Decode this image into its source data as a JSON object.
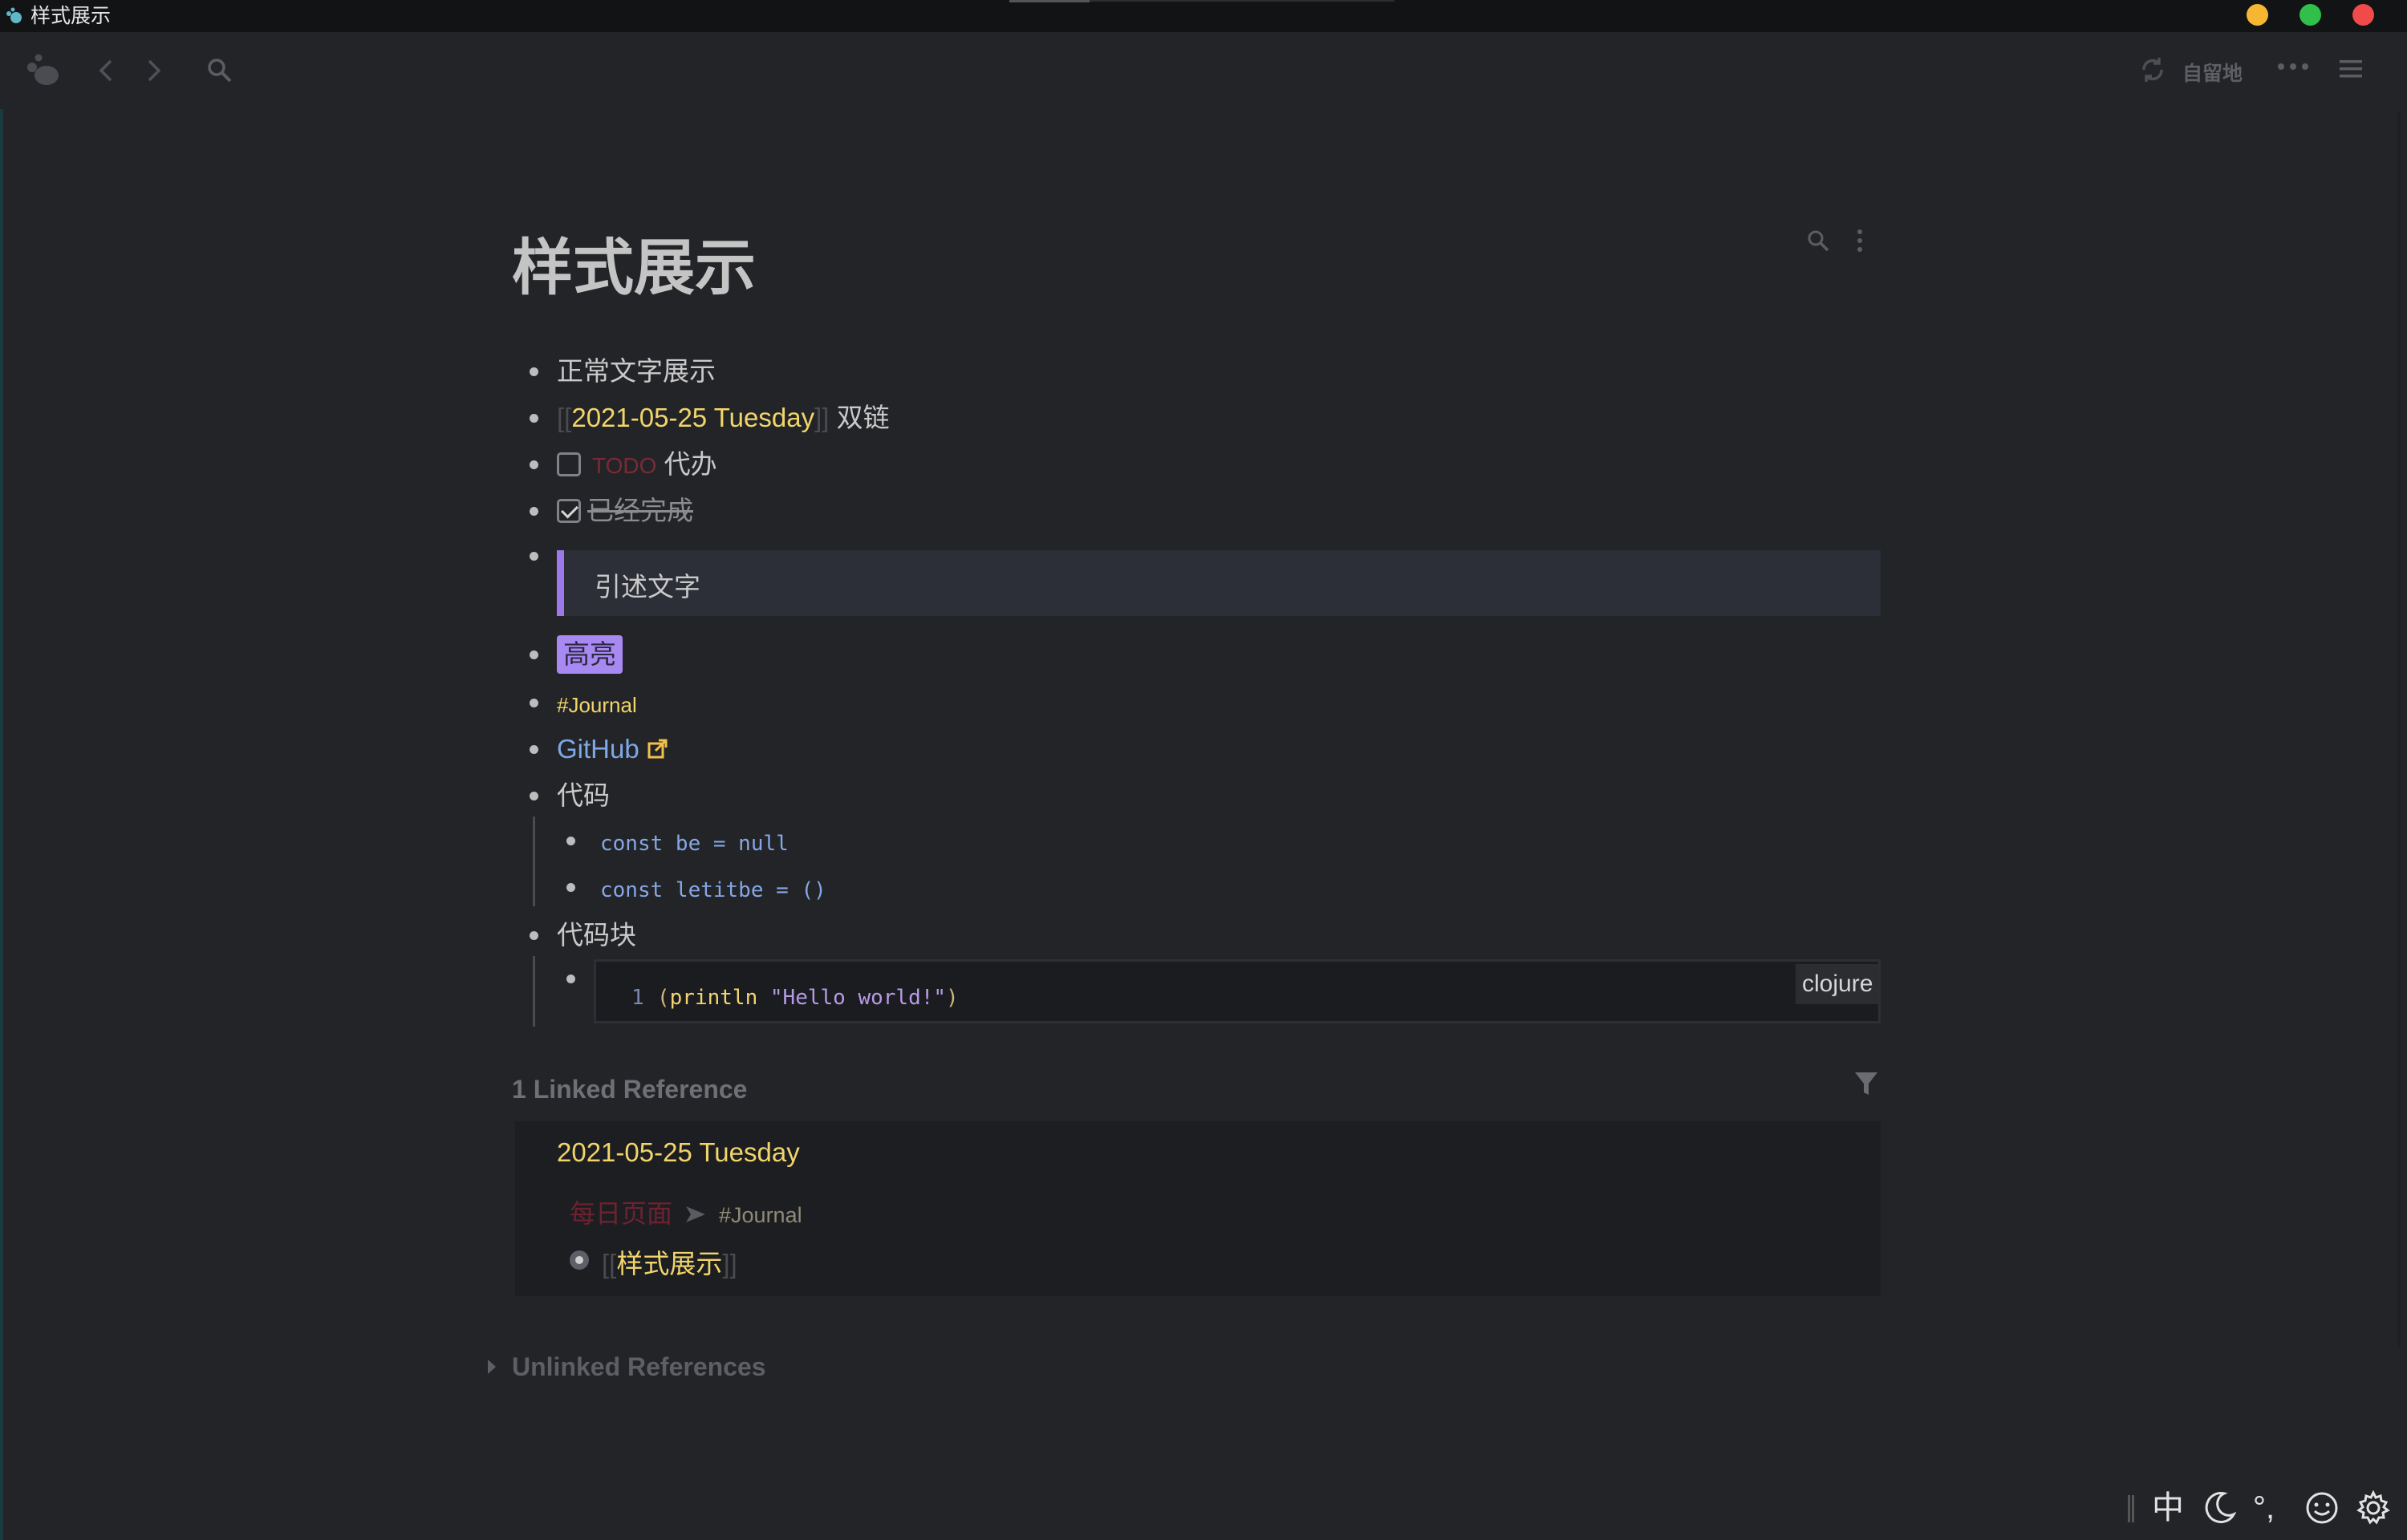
{
  "window": {
    "title": "样式展示"
  },
  "toolbar": {
    "sync_label": "自留地"
  },
  "page": {
    "title": "样式展示",
    "blocks": {
      "plain": "正常文字展示",
      "daily_link": "2021-05-25 Tuesday",
      "daily_link_suffix": "双链",
      "todo_marker": "TODO",
      "todo_text": "代办",
      "done_text": "已经完成",
      "quote": "引述文字",
      "highlight": "高亮",
      "tag": "#Journal",
      "link": "GitHub",
      "code_parent": "代码",
      "code_line_1": "const be = null",
      "code_line_2": "const letitbe = ()",
      "codeblock_parent": "代码块",
      "codeblock": {
        "line_number": "1",
        "paren_open": "(",
        "fn": "println",
        "str": "\"Hello world!\"",
        "paren_close": ")",
        "language": "clojure"
      }
    }
  },
  "linked_refs": {
    "title": "1 Linked Reference",
    "page": "2021-05-25 Tuesday",
    "breadcrumb_page": "每日页面",
    "breadcrumb_tag": "#Journal",
    "ref_text": "样式展示"
  },
  "unlinked_refs": {
    "title": "Unlinked References"
  },
  "ime": {
    "mode": "中",
    "punct": "°,"
  },
  "colors": {
    "background": "#232427",
    "accent_purple": "#9c79e8",
    "page_ref": "#f1d56b",
    "link": "#7ea8e6",
    "todo": "#7a2a35"
  },
  "icons": [
    "app-logo-icon",
    "back-icon",
    "forward-icon",
    "search-icon",
    "sync-icon",
    "more-icon",
    "menu-icon",
    "page-search-icon",
    "page-more-icon",
    "external-link-icon",
    "filter-icon",
    "moon-icon",
    "smile-icon",
    "gear-icon"
  ]
}
